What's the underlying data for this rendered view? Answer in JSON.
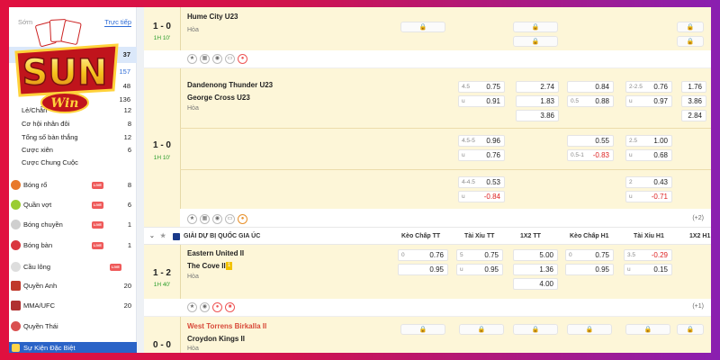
{
  "sidebar": {
    "tab_early": "Sớm",
    "tab_live": "Trực tiếp",
    "top_counts": [
      "37",
      "157",
      "48",
      "136"
    ],
    "sub_items": [
      {
        "label": "Lẻ/Chẵn",
        "count": "12"
      },
      {
        "label": "Cơ hội nhân đôi",
        "count": "8"
      },
      {
        "label": "Tổng số bàn thắng",
        "count": "12"
      },
      {
        "label": "Cược xiên",
        "count": "6"
      },
      {
        "label": "Cược Chung Cuộc",
        "count": ""
      }
    ],
    "sports": [
      {
        "label": "Bóng rổ",
        "count": "8",
        "live": "LIVE",
        "icon": "basketball-icon",
        "color": "#e8782a"
      },
      {
        "label": "Quần vợt",
        "count": "6",
        "live": "LIVE",
        "icon": "tennis-icon",
        "color": "#9acd32"
      },
      {
        "label": "Bóng chuyền",
        "count": "1",
        "live": "LIVE",
        "icon": "volleyball-icon",
        "color": "#cfcfcf"
      },
      {
        "label": "Bóng bàn",
        "count": "1",
        "live": "LIVE",
        "icon": "table-tennis-icon",
        "color": "#d9363e"
      },
      {
        "label": "Cầu lông",
        "count": "",
        "live": "LIVE",
        "icon": "badminton-icon",
        "color": "#dddddd"
      },
      {
        "label": "Quyền Anh",
        "count": "20",
        "live": "",
        "icon": "boxing-icon",
        "color": "#c0392b"
      },
      {
        "label": "MMA/UFC",
        "count": "20",
        "live": "",
        "icon": "mma-icon",
        "color": "#b03030"
      },
      {
        "label": "Quyền Thái",
        "count": "",
        "live": "",
        "icon": "muay-thai-icon",
        "color": "#d95050"
      }
    ],
    "special": "Sự Kiện Đặc Biệt"
  },
  "logo": {
    "text": "SUN",
    "sub": "Win"
  },
  "matches": {
    "m1": {
      "score": "1 - 0",
      "minute": "1H 10'",
      "team1": "Hume City U23",
      "draw": "Hòa"
    },
    "m2": {
      "score": "1 - 0",
      "minute": "1H 10'",
      "team1": "Dandenong Thunder U23",
      "team2": "George Cross U23",
      "draw": "Hòa",
      "r1": {
        "h_hdp": "4.5",
        "hdp": "0.75",
        "u_lbl": "u",
        "u": "0.91",
        "x1": "2.74",
        "x2": "1.83",
        "x3": "3.86",
        "hdp1_h": "0.5",
        "hdp1": "0.84",
        "hdp1b": "0.88",
        "ou1_h": "2-2.5",
        "ou1": "0.76",
        "ou1_u": "u",
        "ou1b": "0.97",
        "c1": "1.76",
        "c2": "3.86",
        "c3": "2.84"
      },
      "r2": {
        "h_hdp": "4.5-5",
        "hdp": "0.96",
        "u_lbl": "u",
        "u": "0.76",
        "hdp1": "0.55",
        "hdp1_h": "0.5-1",
        "hdp1b": "-0.83",
        "ou1_h": "2.5",
        "ou1": "1.00",
        "ou1_u": "u",
        "ou1b": "0.68"
      },
      "r3": {
        "h_hdp": "4-4.5",
        "hdp": "0.53",
        "u_lbl": "u",
        "u": "-0.84",
        "ou1_h": "2",
        "ou1": "0.43",
        "ou1_u": "u",
        "ou1b": "-0.71"
      },
      "more": "(+2)"
    },
    "league": {
      "name": "GIẢI DỰ BỊ QUỐC GIA ÚC",
      "cols": [
        "Kèo Chấp TT",
        "Tài Xỉu TT",
        "1X2 TT",
        "Kèo Chấp H1",
        "Tài Xỉu H1",
        "1X2 H1"
      ]
    },
    "m3": {
      "score": "1 - 2",
      "minute": "1H 40'",
      "team1": "Eastern United II",
      "team2": "The Cove II",
      "badge": "1",
      "draw": "Hòa",
      "hdp_h": "0",
      "hdp": "0.76",
      "hdpb": "0.95",
      "ou_h": "5",
      "ou": "0.75",
      "ou_u": "u",
      "oub": "0.95",
      "x1": "5.00",
      "x2": "1.36",
      "x3": "4.00",
      "hdp1_h": "0",
      "hdp1": "0.75",
      "hdp1b": "0.95",
      "ou1_h": "3.5",
      "ou1": "-0.29",
      "ou1_u": "u",
      "ou1b": "0.15",
      "more": "(+1)"
    },
    "m4": {
      "score": "0 - 0",
      "minute": "1H 5'",
      "team1": "West Torrens Birkalla II",
      "team2": "Croydon Kings II",
      "draw": "Hòa"
    }
  }
}
